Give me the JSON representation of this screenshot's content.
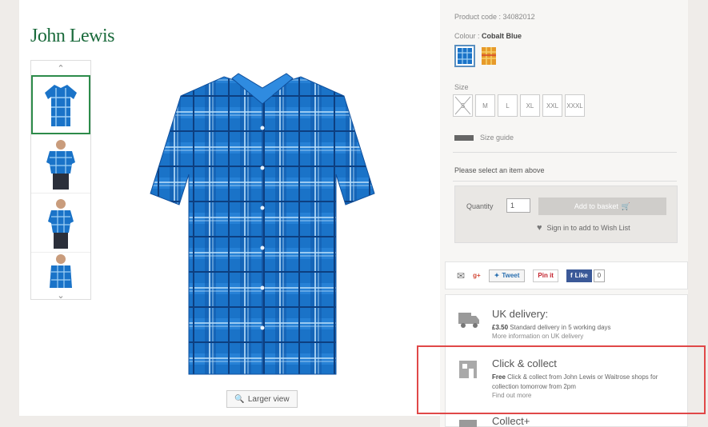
{
  "brand": {
    "logo_text": "John Lewis",
    "logo_color": "#1b6b3c"
  },
  "gallery": {
    "thumbnails": [
      "shirt-front",
      "model-front",
      "model-side",
      "model-back"
    ],
    "larger_view_label": "Larger view"
  },
  "product": {
    "code_label": "Product code : 34082012",
    "colour_label": "Colour :",
    "colour_value": "Cobalt Blue",
    "size_label": "Size",
    "sizes": [
      "S",
      "M",
      "L",
      "XL",
      "XXL",
      "XXXL"
    ],
    "size_guide": "Size guide",
    "select_message": "Please select an item above"
  },
  "basket": {
    "quantity_label": "Quantity",
    "quantity_value": "1",
    "add_button": "Add to basket",
    "wishlist": "Sign in to add to Wish List"
  },
  "share": {
    "tweet": "Tweet",
    "pin": "Pin it",
    "like": "Like",
    "like_count": "0"
  },
  "delivery": {
    "uk_title": "UK delivery:",
    "uk_price": "£3.50",
    "uk_text": "Standard delivery in 5 working days",
    "uk_link": "More information on UK delivery",
    "cc_title": "Click & collect",
    "cc_free": "Free",
    "cc_text": "Click & collect from John Lewis or Waitrose shops for collection tomorrow from 2pm",
    "cc_link": "Find out more",
    "collect_plus_title": "Collect+"
  },
  "colors": {
    "accent_green": "#2d8b4a",
    "highlight_red": "#e04848",
    "shirt_blue": "#1a73c8"
  }
}
